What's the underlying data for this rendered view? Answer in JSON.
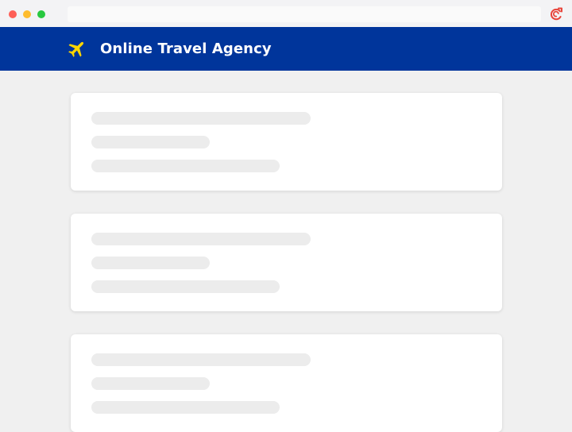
{
  "browser": {
    "controls": [
      "close",
      "minimize",
      "maximize"
    ],
    "colors": {
      "close": "#fe5f57",
      "minimize": "#febc2e",
      "maximize": "#28c840",
      "extension_icon": "#e8443a"
    },
    "extension_icon": "refresh-extension-icon"
  },
  "header": {
    "title": "Online Travel Agency",
    "icon": "airplane-icon",
    "colors": {
      "background": "#00359b",
      "icon": "#ffd500"
    }
  },
  "results": {
    "state": "loading",
    "cards": [
      {
        "placeholder_lines": 3
      },
      {
        "placeholder_lines": 3
      },
      {
        "placeholder_lines": 3
      }
    ]
  }
}
